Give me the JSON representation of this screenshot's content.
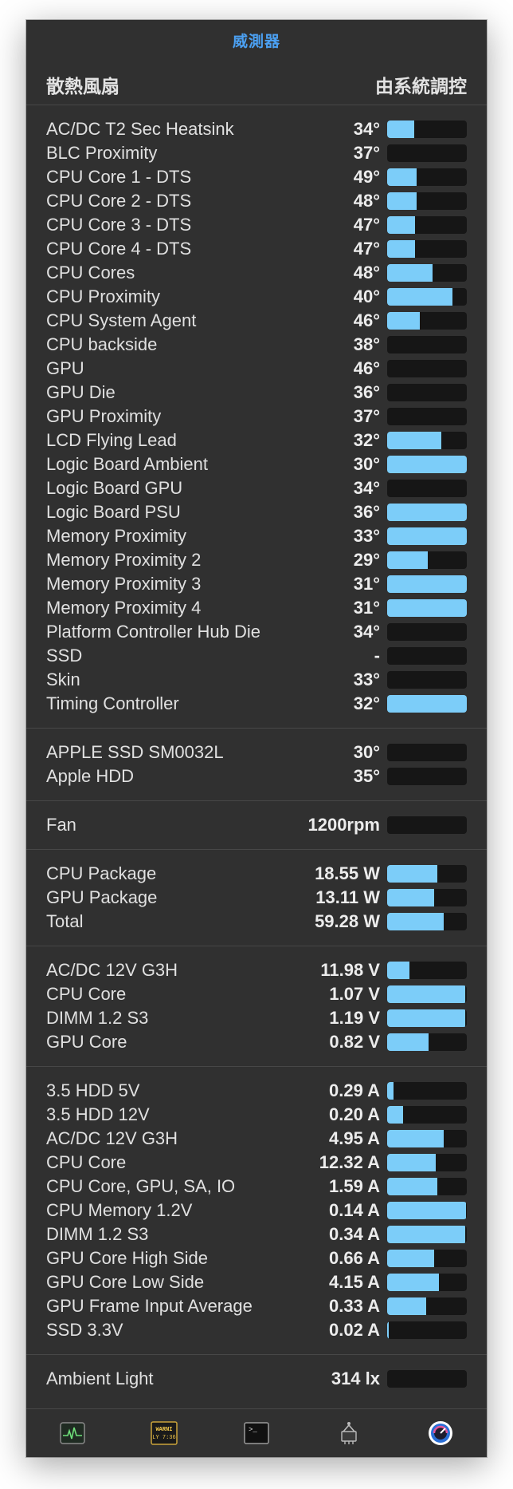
{
  "title": "威測器",
  "fan_control": {
    "label": "散熱風扇",
    "status": "由系統調控"
  },
  "sections": [
    {
      "name": "temperatures",
      "rows": [
        {
          "label": "AC/DC T2 Sec Heatsink",
          "value": "34°",
          "level": 0.34
        },
        {
          "label": "BLC Proximity",
          "value": "37°",
          "level": 0.0
        },
        {
          "label": "CPU Core 1 - DTS",
          "value": "49°",
          "level": 0.37
        },
        {
          "label": "CPU Core 2 - DTS",
          "value": "48°",
          "level": 0.37
        },
        {
          "label": "CPU Core 3 - DTS",
          "value": "47°",
          "level": 0.35
        },
        {
          "label": "CPU Core 4 - DTS",
          "value": "47°",
          "level": 0.35
        },
        {
          "label": "CPU Cores",
          "value": "48°",
          "level": 0.57
        },
        {
          "label": "CPU Proximity",
          "value": "40°",
          "level": 0.82
        },
        {
          "label": "CPU System Agent",
          "value": "46°",
          "level": 0.41
        },
        {
          "label": "CPU backside",
          "value": "38°",
          "level": 0.0
        },
        {
          "label": "GPU",
          "value": "46°",
          "level": 0.0
        },
        {
          "label": "GPU Die",
          "value": "36°",
          "level": 0.0
        },
        {
          "label": "GPU Proximity",
          "value": "37°",
          "level": 0.0
        },
        {
          "label": "LCD Flying Lead",
          "value": "32°",
          "level": 0.68
        },
        {
          "label": "Logic Board Ambient",
          "value": "30°",
          "level": 1.0
        },
        {
          "label": "Logic Board GPU",
          "value": "34°",
          "level": 0.0
        },
        {
          "label": "Logic Board PSU",
          "value": "36°",
          "level": 1.0
        },
        {
          "label": "Memory Proximity",
          "value": "33°",
          "level": 1.0
        },
        {
          "label": "Memory Proximity 2",
          "value": "29°",
          "level": 0.51
        },
        {
          "label": "Memory Proximity 3",
          "value": "31°",
          "level": 1.0
        },
        {
          "label": "Memory Proximity 4",
          "value": "31°",
          "level": 1.0
        },
        {
          "label": "Platform Controller Hub Die",
          "value": "34°",
          "level": 0.0
        },
        {
          "label": "SSD",
          "value": "-",
          "level": 0.0
        },
        {
          "label": "Skin",
          "value": "33°",
          "level": 0.0
        },
        {
          "label": "Timing Controller",
          "value": "32°",
          "level": 1.0
        }
      ]
    },
    {
      "name": "disks",
      "rows": [
        {
          "label": "APPLE SSD SM0032L",
          "value": "30°",
          "level": 0.0
        },
        {
          "label": "Apple HDD",
          "value": "35°",
          "level": 0.0
        }
      ]
    },
    {
      "name": "fans",
      "rows": [
        {
          "label": "Fan",
          "value": "1200rpm",
          "level": 0.0
        }
      ]
    },
    {
      "name": "power",
      "rows": [
        {
          "label": "CPU Package",
          "value": "18.55 W",
          "level": 0.63
        },
        {
          "label": "GPU Package",
          "value": "13.11 W",
          "level": 0.59
        },
        {
          "label": "Total",
          "value": "59.28 W",
          "level": 0.71
        }
      ]
    },
    {
      "name": "voltage",
      "rows": [
        {
          "label": "AC/DC 12V G3H",
          "value": "11.98 V",
          "level": 0.28
        },
        {
          "label": "CPU Core",
          "value": "1.07 V",
          "level": 0.98
        },
        {
          "label": "DIMM 1.2 S3",
          "value": "1.19 V",
          "level": 0.98
        },
        {
          "label": "GPU Core",
          "value": "0.82 V",
          "level": 0.52
        }
      ]
    },
    {
      "name": "current",
      "rows": [
        {
          "label": "3.5 HDD 5V",
          "value": "0.29 A",
          "level": 0.08
        },
        {
          "label": "3.5 HDD 12V",
          "value": "0.20 A",
          "level": 0.2
        },
        {
          "label": "AC/DC 12V G3H",
          "value": "4.95 A",
          "level": 0.71
        },
        {
          "label": "CPU Core",
          "value": "12.32 A",
          "level": 0.61
        },
        {
          "label": "CPU Core, GPU, SA, IO",
          "value": "1.59 A",
          "level": 0.63
        },
        {
          "label": "CPU Memory 1.2V",
          "value": "0.14 A",
          "level": 0.99
        },
        {
          "label": "DIMM 1.2 S3",
          "value": "0.34 A",
          "level": 0.98
        },
        {
          "label": "GPU Core High Side",
          "value": "0.66 A",
          "level": 0.59
        },
        {
          "label": "GPU Core Low Side",
          "value": "4.15 A",
          "level": 0.65
        },
        {
          "label": "GPU Frame Input Average",
          "value": "0.33 A",
          "level": 0.49
        },
        {
          "label": "SSD 3.3V",
          "value": "0.02 A",
          "level": 0.02
        }
      ]
    },
    {
      "name": "light",
      "rows": [
        {
          "label": "Ambient Light",
          "value": "314 lx",
          "level": 0.0
        }
      ]
    }
  ],
  "footer_icons": [
    {
      "name": "activity-monitor-icon",
      "label": ""
    },
    {
      "name": "console-icon",
      "label": "WARNI LY 7:36"
    },
    {
      "name": "terminal-icon",
      "label": ">_"
    },
    {
      "name": "system-information-icon",
      "label": ""
    },
    {
      "name": "istat-menus-icon",
      "label": ""
    }
  ],
  "colors": {
    "window_bg": "#303030",
    "bar_fill": "#7ccdf9",
    "bar_track": "#161616",
    "title": "#4ba0f2"
  }
}
